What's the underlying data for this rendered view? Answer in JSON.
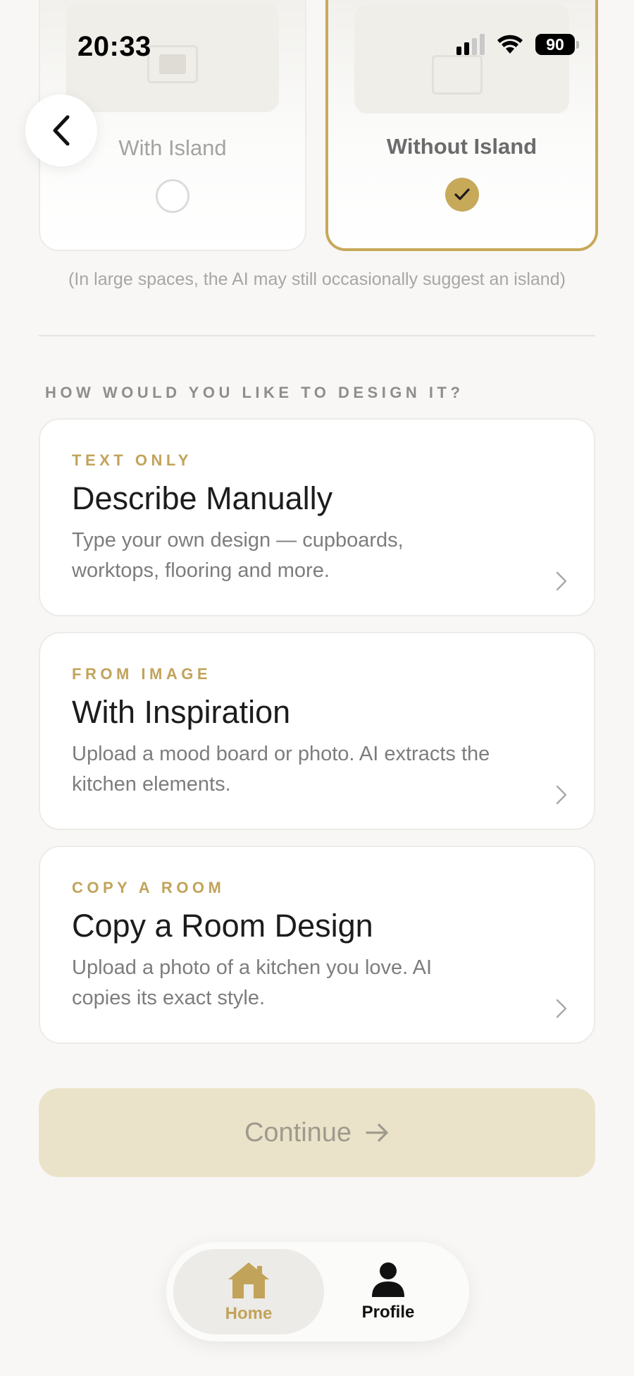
{
  "status_bar": {
    "time": "20:33",
    "battery": "90",
    "icons": [
      "signal-icon",
      "wifi-icon",
      "battery-icon"
    ]
  },
  "island_options": {
    "left_label": "With Island",
    "right_label": "Without Island",
    "selected": "Without Island",
    "note": "(In large spaces, the AI may still occasionally suggest an island)"
  },
  "design_section": {
    "heading": "HOW WOULD YOU LIKE TO DESIGN IT?",
    "options": [
      {
        "tag": "TEXT ONLY",
        "title": "Describe Manually",
        "description": "Type your own design — cupboards, worktops, flooring and more."
      },
      {
        "tag": "FROM IMAGE",
        "title": "With Inspiration",
        "description": "Upload a mood board or photo. AI extracts the kitchen elements."
      },
      {
        "tag": "COPY A ROOM",
        "title": "Copy a Room Design",
        "description": "Upload a photo of a kitchen you love. AI copies its exact style."
      }
    ]
  },
  "continue_label": "Continue",
  "tab_bar": {
    "home_label": "Home",
    "profile_label": "Profile",
    "active": "Home"
  },
  "colors": {
    "accent": "#c7a95a",
    "continue_disabled_bg": "#ebe3c9",
    "background": "#f8f7f5"
  }
}
